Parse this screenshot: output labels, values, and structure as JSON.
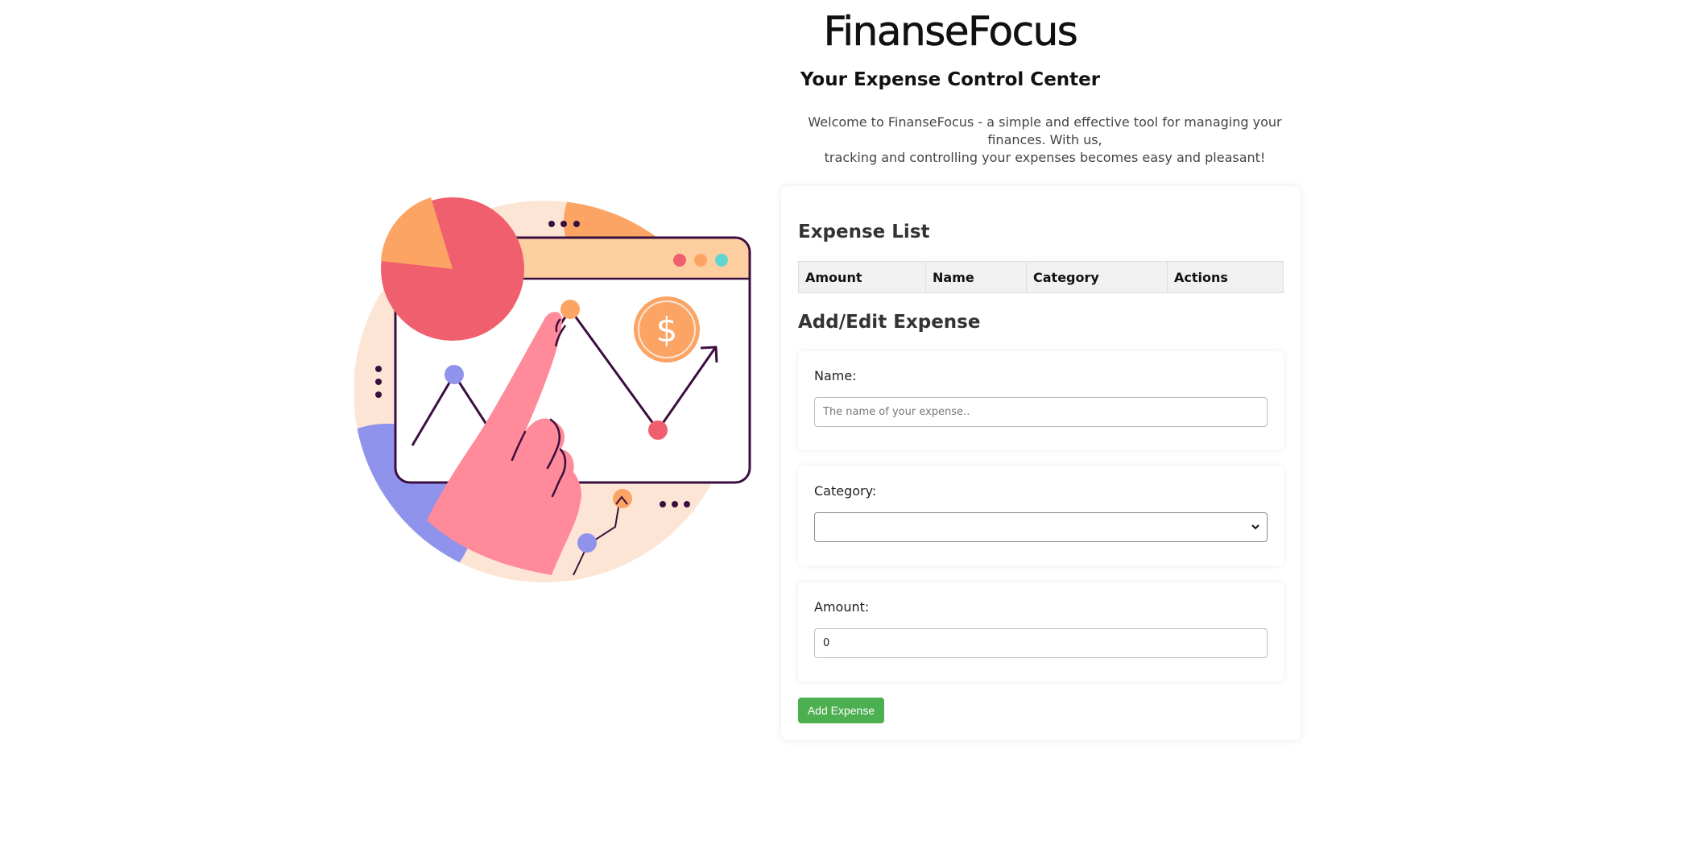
{
  "header": {
    "title": "FinanseFocus",
    "subtitle": "Your Expense Control Center",
    "intro_line1": "Welcome to FinanseFocus - a simple and effective tool for managing your finances. With us,",
    "intro_line2": "tracking and controlling your expenses becomes easy and pleasant!"
  },
  "illustration": {
    "icon": "finance-analytics-illustration",
    "currency_symbol": "$",
    "colors": {
      "backdrop": "#fde5d6",
      "pie_main": "#ef5f6d",
      "pie_slice": "#fba464",
      "window_bar": "#fdcfa0",
      "hand": "#ff8a99",
      "accent_blue": "#9093ec",
      "outline": "#3a0f3f",
      "dot_red": "#ef5f6d",
      "dot_orange": "#fba464",
      "dot_teal": "#5fd6d0"
    }
  },
  "expense_list": {
    "heading": "Expense List",
    "columns": [
      "Amount",
      "Name",
      "Category",
      "Actions"
    ],
    "rows": []
  },
  "form": {
    "heading": "Add/Edit Expense",
    "name": {
      "label": "Name:",
      "value": "",
      "placeholder": "The name of your expense.."
    },
    "category": {
      "label": "Category:",
      "selected": ""
    },
    "amount": {
      "label": "Amount:",
      "value": "0"
    },
    "submit_label": "Add Expense"
  },
  "colors": {
    "primary_button": "#4caf50",
    "table_header_bg": "#f1f1f1"
  }
}
